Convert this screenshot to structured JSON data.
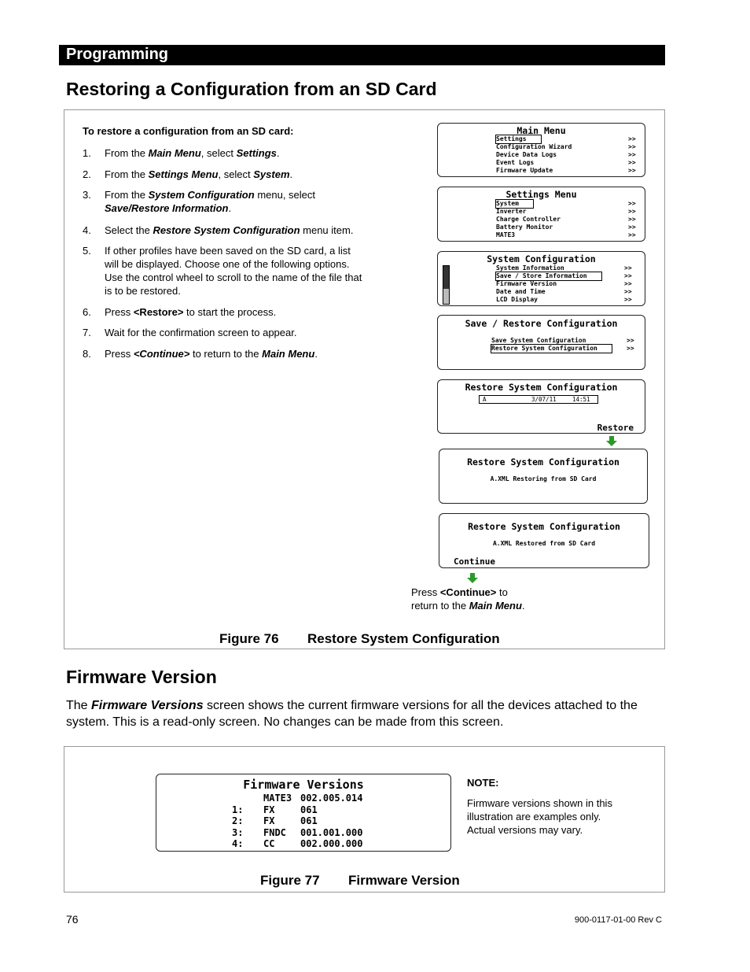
{
  "header": {
    "section": "Programming"
  },
  "restore": {
    "title": "Restoring a Configuration from an SD Card",
    "intro": "To restore a configuration from an SD card:",
    "steps": [
      {
        "n": "1.",
        "seg": [
          [
            "From the ",
            ""
          ],
          [
            "Main Menu",
            "bi"
          ],
          [
            ", select ",
            ""
          ],
          [
            "Settings",
            "bi"
          ],
          [
            ".",
            ""
          ]
        ]
      },
      {
        "n": "2.",
        "seg": [
          [
            "From the ",
            ""
          ],
          [
            "Settings Menu",
            "bi"
          ],
          [
            ", select ",
            ""
          ],
          [
            "System",
            "bi"
          ],
          [
            ".",
            ""
          ]
        ]
      },
      {
        "n": "3.",
        "seg": [
          [
            "From the ",
            ""
          ],
          [
            "System Configuration",
            "bi"
          ],
          [
            " menu, select ",
            ""
          ],
          [
            "Save/Restore Information",
            "bi"
          ],
          [
            ".",
            ""
          ]
        ]
      },
      {
        "n": "4.",
        "seg": [
          [
            "Select the ",
            ""
          ],
          [
            "Restore System Configuration",
            "bi"
          ],
          [
            " menu item.",
            ""
          ]
        ]
      },
      {
        "n": "5.",
        "seg": [
          [
            "If other profiles have been saved on the SD card, a list will be displayed.  Choose one of the following options.  Use the control wheel to scroll to the name of the file that is to be restored.",
            ""
          ]
        ]
      },
      {
        "n": "6.",
        "seg": [
          [
            "Press ",
            ""
          ],
          [
            "<Restore>",
            "b"
          ],
          [
            " to start the process.",
            ""
          ]
        ]
      },
      {
        "n": "7.",
        "seg": [
          [
            "Wait for the confirmation screen to appear.",
            ""
          ]
        ]
      },
      {
        "n": "8.",
        "seg": [
          [
            "Press ",
            ""
          ],
          [
            "<Continue>",
            "bi"
          ],
          [
            " to return to the ",
            ""
          ],
          [
            "Main Menu",
            "bi"
          ],
          [
            ".",
            ""
          ]
        ]
      }
    ],
    "screens": {
      "main_menu": {
        "title": "Main Menu",
        "items": [
          "Settings",
          "Configuration Wizard",
          "Device Data Logs",
          "Event Logs",
          "Firmware Update"
        ],
        "selected": 0,
        "arrow": ">>"
      },
      "settings_menu": {
        "title": "Settings Menu",
        "items": [
          "System",
          "Inverter",
          "Charge Controller",
          "Battery Monitor",
          "MATE3"
        ],
        "selected": 0,
        "arrow": ">>"
      },
      "system_config": {
        "title": "System Configuration",
        "items": [
          "System Information",
          "Save / Store Information",
          "Firmware Version",
          "Date and Time",
          "LCD Display"
        ],
        "selected": 1,
        "arrow": ">>",
        "scroll_position": 0.6
      },
      "save_restore": {
        "title": "Save / Restore Configuration",
        "items": [
          "Save System Configuration",
          "Restore System Configuration"
        ],
        "selected": 1,
        "arrow": ">>"
      },
      "restore_select": {
        "title": "Restore System Configuration",
        "file_name": "A",
        "file_date": "3/07/11",
        "file_time": "14:51",
        "softkey": "Restore"
      },
      "restoring": {
        "title": "Restore System Configuration",
        "message": "A.XML Restoring from SD Card"
      },
      "restored": {
        "title": "Restore System Configuration",
        "message": "A.XML Restored from SD Card",
        "softkey": "Continue"
      }
    },
    "press_note": {
      "l1a": "Press ",
      "l1b": "<Continue>",
      "l1c": " to",
      "l2a": "return to the ",
      "l2b": "Main Menu",
      "l2c": "."
    },
    "figure_label": "Figure 76",
    "figure_title": "Restore System Configuration"
  },
  "firmware": {
    "title": "Firmware Version",
    "para_a": "The ",
    "para_b": "Firmware Versions",
    "para_c": " screen shows the current firmware versions for all the devices attached to the system.  This is a read-only screen.  No changes can be made from this screen.",
    "screen": {
      "title": "Firmware Versions",
      "rows": [
        {
          "port": "",
          "device": "MATE3",
          "version": "002.005.014"
        },
        {
          "port": "1:",
          "device": "FX",
          "version": "061"
        },
        {
          "port": "2:",
          "device": "FX",
          "version": "061"
        },
        {
          "port": "3:",
          "device": "FNDC",
          "version": "001.001.000"
        },
        {
          "port": "4:",
          "device": "CC",
          "version": "002.000.000"
        }
      ]
    },
    "note_label": "NOTE:",
    "note_lines": [
      "Firmware versions shown in this",
      "illustration are examples only.",
      "Actual versions may vary."
    ],
    "figure_label": "Figure 77",
    "figure_title": "Firmware Version"
  },
  "footer": {
    "page": "76",
    "doc": "900-0117-01-00 Rev C"
  },
  "colors": {
    "header_bg": "#000000",
    "arrow": "#2a9a2a"
  }
}
